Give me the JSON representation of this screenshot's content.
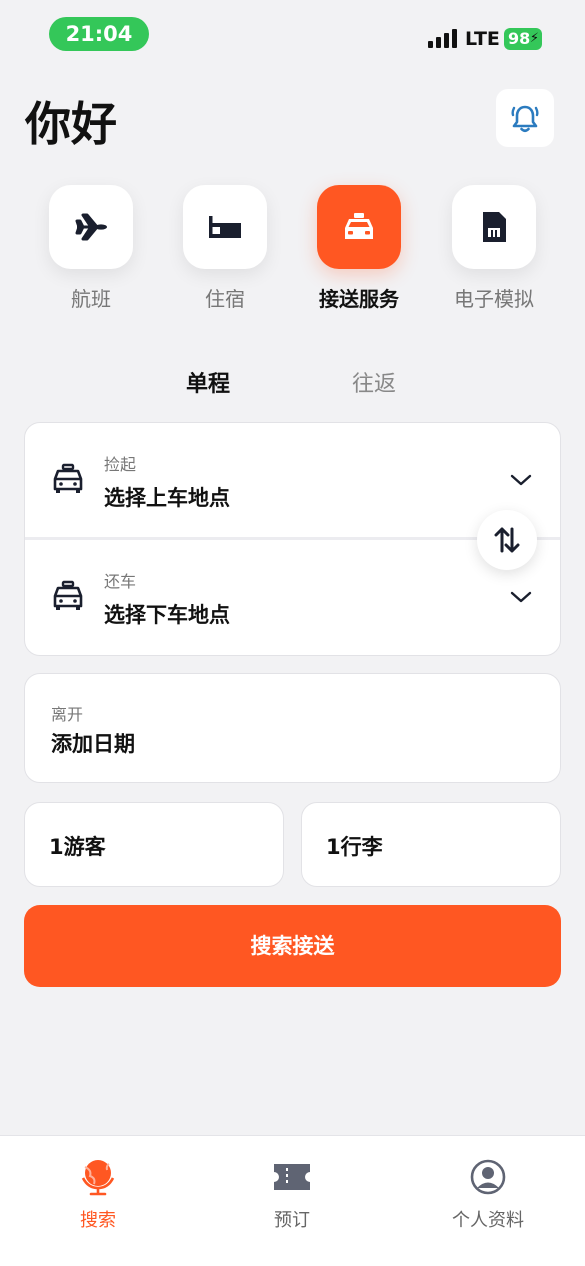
{
  "status_bar": {
    "time": "21:04",
    "network": "LTE",
    "battery": "98"
  },
  "header": {
    "greeting": "你好"
  },
  "categories": [
    {
      "label": "航班",
      "icon": "airplane-icon"
    },
    {
      "label": "住宿",
      "icon": "bed-icon"
    },
    {
      "label": "接送服务",
      "icon": "taxi-icon",
      "active": true
    },
    {
      "label": "电子模拟",
      "icon": "sim-card-icon"
    }
  ],
  "trip_type": {
    "one_way": "单程",
    "round_trip": "往返",
    "selected": "单程"
  },
  "pickup": {
    "caption": "捡起",
    "value": "选择上车地点"
  },
  "dropoff": {
    "caption": "还车",
    "value": "选择下车地点"
  },
  "departure": {
    "caption": "离开",
    "value": "添加日期"
  },
  "travelers": {
    "value": "1游客"
  },
  "luggage": {
    "value": "1行李"
  },
  "search_button": {
    "label": "搜索接送"
  },
  "bottom_nav": [
    {
      "label": "搜索",
      "icon": "globe-icon",
      "active": true
    },
    {
      "label": "预订",
      "icon": "ticket-icon"
    },
    {
      "label": "个人资料",
      "icon": "profile-icon"
    }
  ],
  "colors": {
    "accent": "#ff5722",
    "status_green": "#34c759",
    "background": "#f2f2f4"
  }
}
